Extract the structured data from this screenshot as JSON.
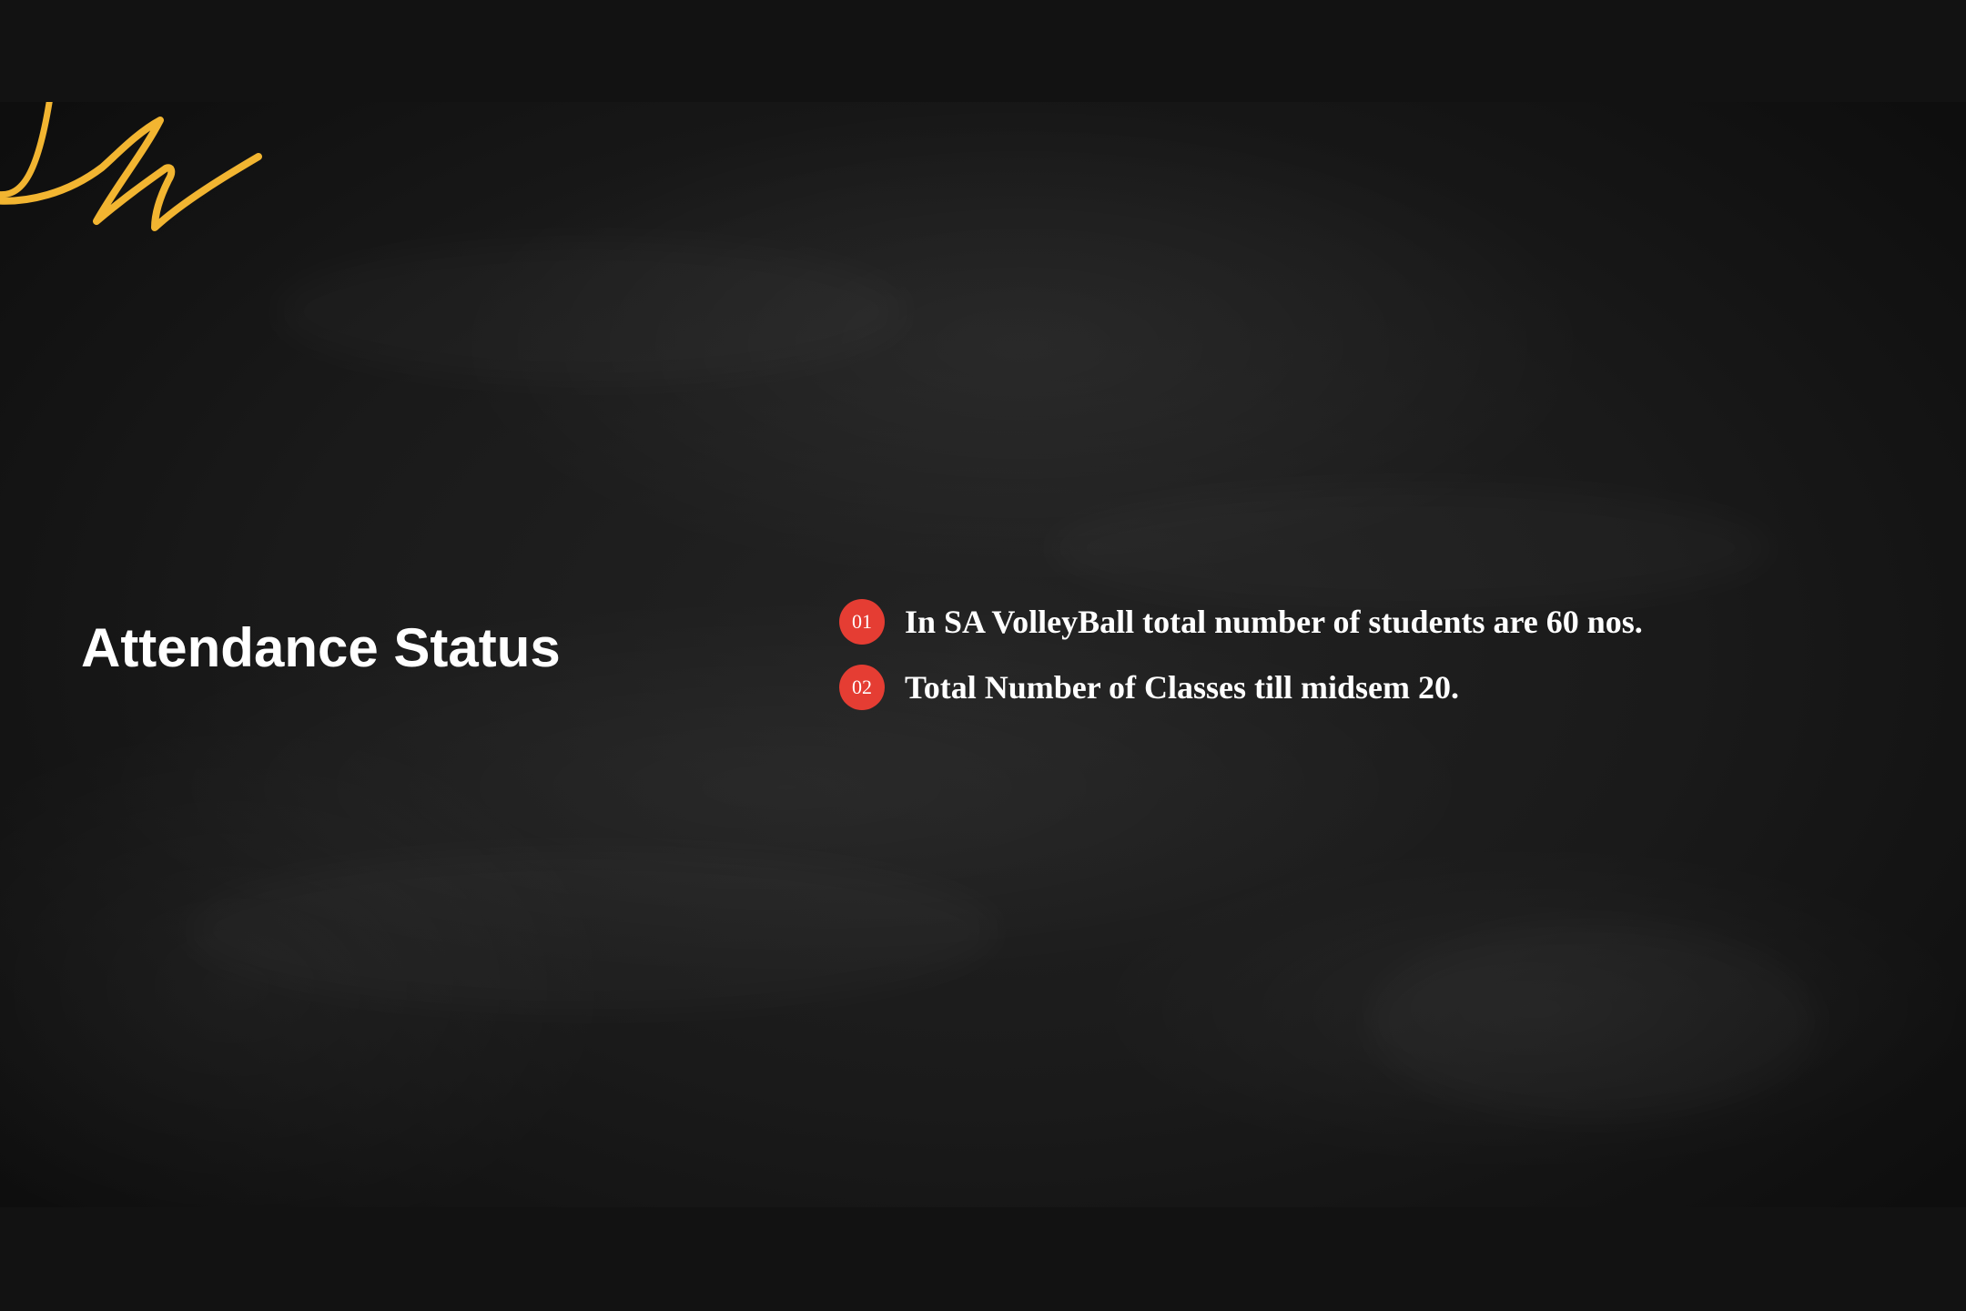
{
  "slide": {
    "title": "Attendance Status",
    "points": [
      {
        "number": "01",
        "text": "In SA VolleyBall total number of students are 60 nos."
      },
      {
        "number": "02",
        "text": "Total Number of Classes till midsem 20."
      }
    ]
  },
  "colors": {
    "background": "#1c1c1c",
    "letterbox": "#121212",
    "accent_badge": "#e53d33",
    "squiggle": "#f2b531",
    "text": "#ffffff"
  },
  "icons": {
    "decoration": "chalk-squiggle-icon"
  }
}
